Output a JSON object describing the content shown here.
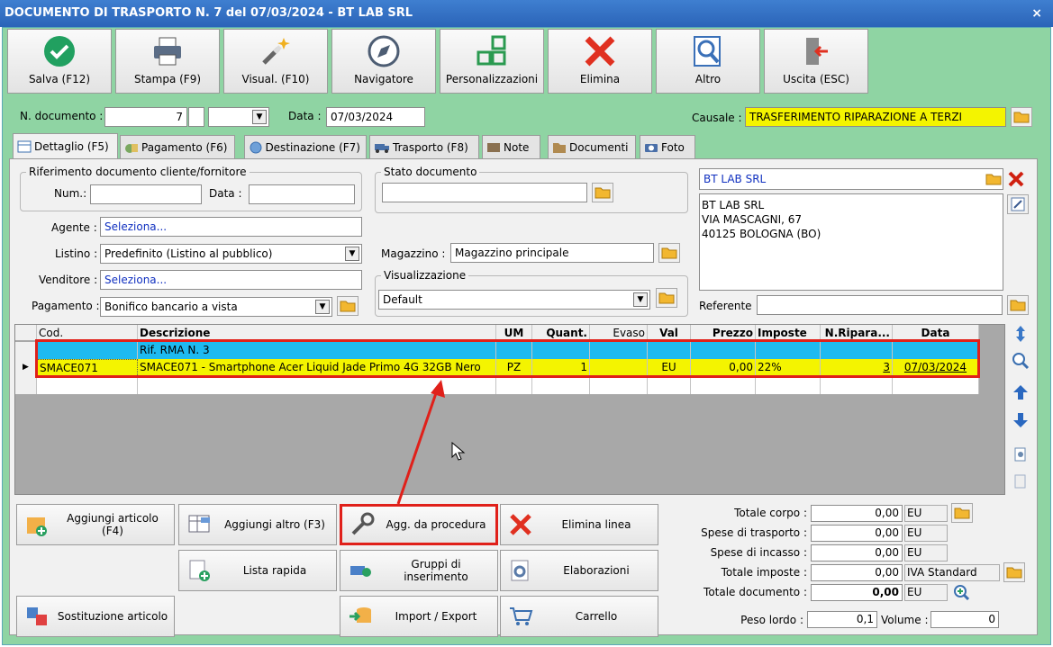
{
  "window": {
    "title": "DOCUMENTO DI TRASPORTO N. 7 del 07/03/2024 - BT LAB SRL",
    "close": "×"
  },
  "toolbar": [
    {
      "label": "Salva (F12)",
      "icon": "check-icon"
    },
    {
      "label": "Stampa (F9)",
      "icon": "printer-icon"
    },
    {
      "label": "Visual. (F10)",
      "icon": "wand-icon"
    },
    {
      "label": "Navigatore",
      "icon": "compass-icon"
    },
    {
      "label": "Personalizzazioni",
      "icon": "grid-icon"
    },
    {
      "label": "Elimina",
      "icon": "delete-x-icon"
    },
    {
      "label": "Altro",
      "icon": "magnifier-icon"
    },
    {
      "label": "Uscita (ESC)",
      "icon": "exit-door-icon"
    }
  ],
  "header": {
    "ndoc_label": "N. documento :",
    "ndoc_value": "7",
    "data_label": "Data :",
    "data_value": "07/03/2024",
    "causale_label": "Causale :",
    "causale_value": "TRASFERIMENTO RIPARAZIONE A TERZI"
  },
  "tabs": [
    "Dettaglio (F5)",
    "Pagamento (F6)",
    "Destinazione (F7)",
    "Trasporto (F8)",
    "Note",
    "Documenti",
    "Foto"
  ],
  "rif": {
    "title": "Riferimento documento cliente/fornitore",
    "num_label": "Num.:",
    "data_label": "Data :"
  },
  "stato": {
    "title": "Stato documento"
  },
  "form": {
    "agente_label": "Agente :",
    "agente_value": "Seleziona...",
    "listino_label": "Listino :",
    "listino_value": "Predefinito (Listino al pubblico)",
    "venditore_label": "Venditore :",
    "venditore_value": "Seleziona...",
    "pagamento_label": "Pagamento :",
    "pagamento_value": "Bonifico bancario a vista",
    "magazzino_label": "Magazzino :",
    "magazzino_value": "Magazzino principale",
    "visual_title": "Visualizzazione",
    "visual_value": "Default"
  },
  "cliente": {
    "name": "BT LAB SRL",
    "addr1": "BT LAB SRL",
    "addr2": "VIA MASCAGNI, 67",
    "addr3": "40125 BOLOGNA (BO)",
    "referente_label": "Referente"
  },
  "grid": {
    "columns": [
      "Cod.",
      "Descrizione",
      "UM",
      "Quant.",
      "Evaso",
      "Val",
      "Prezzo",
      "Imposte",
      "N.Ripara...",
      "Data"
    ],
    "row1": {
      "desc": "Rif. RMA N. 3"
    },
    "row2": {
      "cod": "SMACE071",
      "desc": "SMACE071 - Smartphone Acer Liquid Jade Primo 4G 32GB Nero",
      "um": "PZ",
      "quant": "1",
      "val": "EU",
      "prezzo": "0,00",
      "imposte": "22%",
      "nrip": "3",
      "data": "07/03/2024"
    }
  },
  "actions": {
    "aggiungi_articolo": "Aggiungi articolo (F4)",
    "aggiungi_altro": "Aggiungi altro (F3)",
    "agg_procedura": "Agg. da procedura",
    "elimina_linea": "Elimina linea",
    "lista_rapida": "Lista rapida",
    "gruppi": "Gruppi di inserimento",
    "elaborazioni": "Elaborazioni",
    "sostituzione": "Sostituzione articolo",
    "import_export": "Import / Export",
    "carrello": "Carrello"
  },
  "totals": {
    "corpo_label": "Totale corpo :",
    "corpo_value": "0,00",
    "trasporto_label": "Spese di trasporto :",
    "trasporto_value": "0,00",
    "incasso_label": "Spese di incasso :",
    "incasso_value": "0,00",
    "imposte_label": "Totale imposte :",
    "imposte_value": "0,00",
    "iva": "IVA Standard",
    "documento_label": "Totale documento :",
    "documento_value": "0,00",
    "currency": "EU",
    "peso_label": "Peso lordo :",
    "peso_value": "0,1",
    "volume_label": "Volume :",
    "volume_value": "0"
  },
  "colors": {
    "row_blue": "#1ebaf0",
    "row_yellow": "#f4f400",
    "highlight": "#e0201a"
  }
}
